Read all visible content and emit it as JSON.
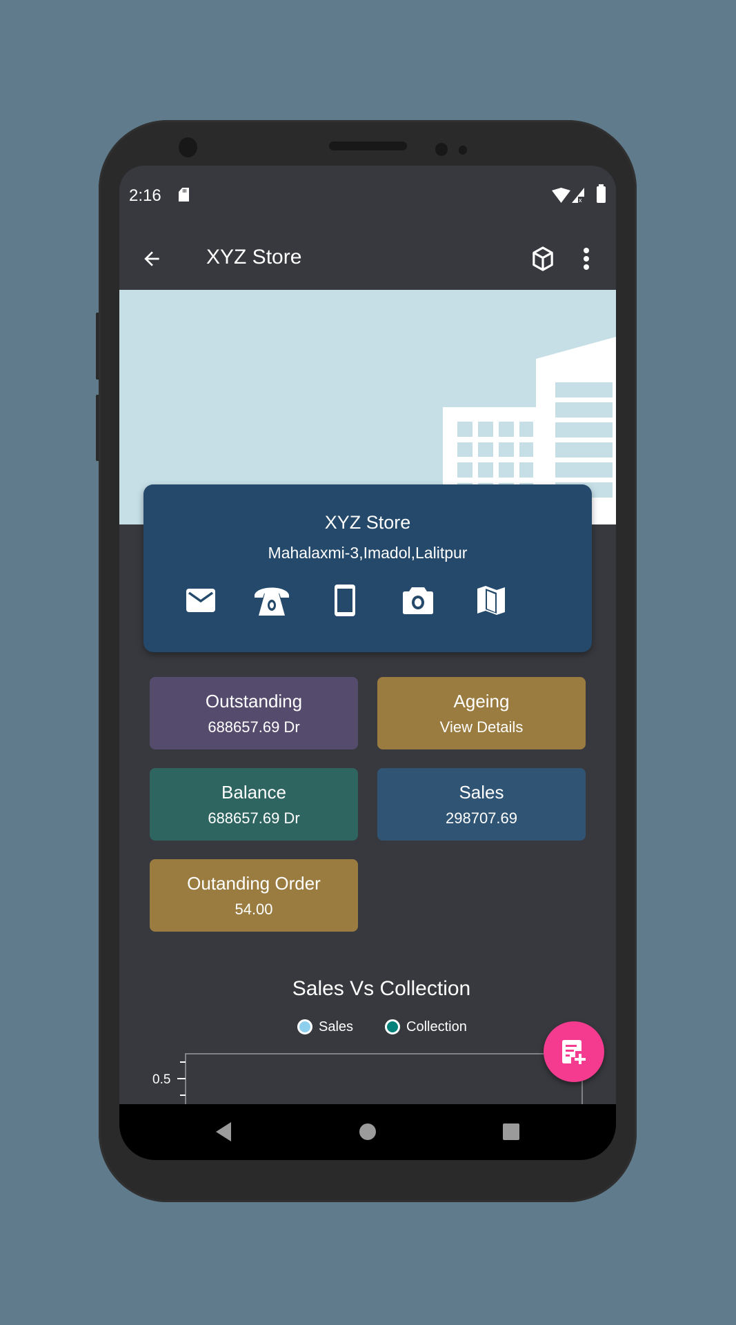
{
  "status_bar": {
    "time": "2:16",
    "icons": [
      "sd-card-icon",
      "wifi-icon",
      "signal-no-data-icon",
      "battery-icon"
    ]
  },
  "app_bar": {
    "title": "XYZ Store",
    "back_icon": "arrow-back-icon",
    "action_icons": [
      "cube-icon",
      "more-vert-icon"
    ]
  },
  "store_card": {
    "name": "XYZ Store",
    "address": "Mahalaxmi-3,Imadol,Lalitpur",
    "actions": [
      "email-icon",
      "phone-icon",
      "mobile-icon",
      "camera-icon",
      "map-icon"
    ]
  },
  "tiles": [
    {
      "title": "Outstanding",
      "value": "688657.69 Dr",
      "color": "#554c6d"
    },
    {
      "title": "Ageing",
      "value": "View Details",
      "color": "#9a7c40"
    },
    {
      "title": "Balance",
      "value": "688657.69 Dr",
      "color": "#2f6561"
    },
    {
      "title": "Sales",
      "value": "298707.69",
      "color": "#305574"
    },
    {
      "title": "Outanding Order",
      "value": "54.00",
      "color": "#9a7c40"
    }
  ],
  "chart_data": {
    "type": "line",
    "title": "Sales Vs Collection",
    "legend": [
      {
        "name": "Sales",
        "color": "#8ecfee"
      },
      {
        "name": "Collection",
        "color": "#00827a"
      }
    ],
    "legend_position": "top-center",
    "y_tick_labels": [
      "0.5"
    ],
    "series": [
      {
        "name": "Sales",
        "values": []
      },
      {
        "name": "Collection",
        "values": []
      }
    ],
    "xlabel": "",
    "ylabel": ""
  },
  "fab": {
    "icon": "add-note-icon"
  },
  "nav_bar": {
    "buttons": [
      "back-triangle-icon",
      "home-circle-icon",
      "recents-square-icon"
    ]
  },
  "colors": {
    "background": "#5f7b8c",
    "screen": "#38393e",
    "card": "#24496a",
    "banner": "#c6dfe7",
    "fab": "#f53b8f"
  }
}
